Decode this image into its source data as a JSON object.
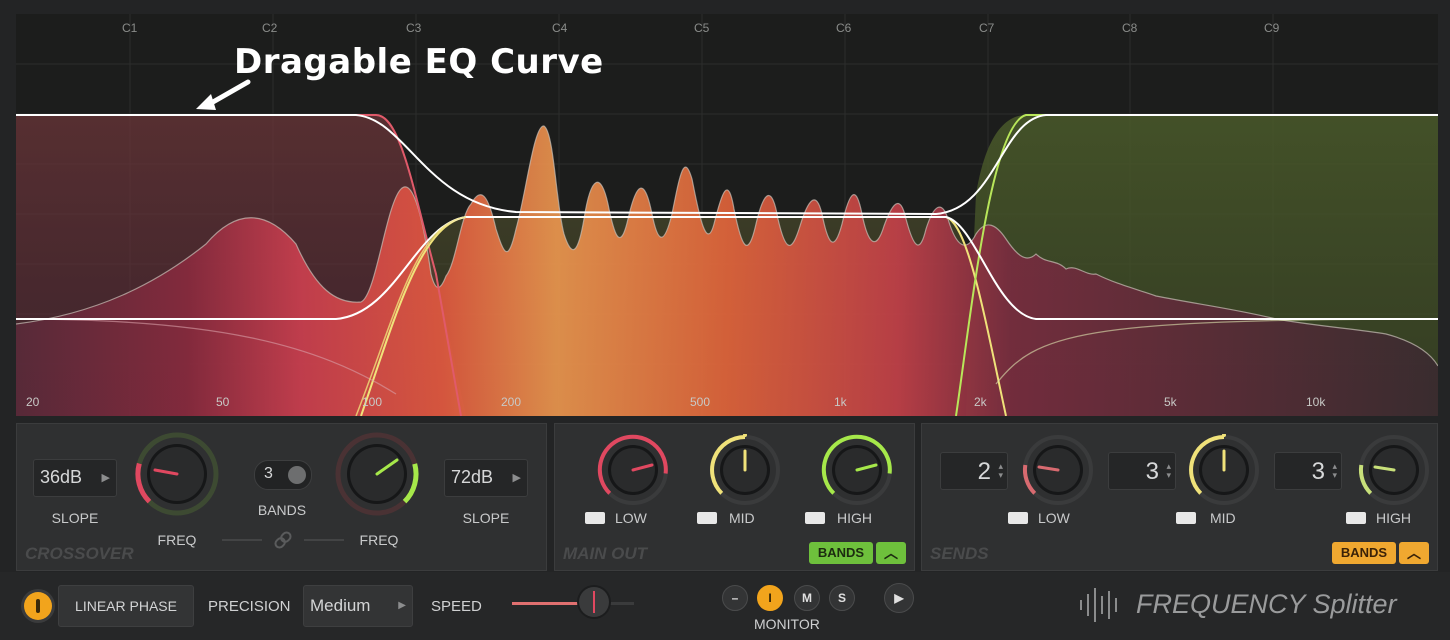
{
  "eq": {
    "annotation": "Dragable EQ Curve",
    "note_labels": [
      "C1",
      "C2",
      "C3",
      "C4",
      "C5",
      "C6",
      "C7",
      "C8",
      "C9"
    ],
    "freq_labels": [
      "20",
      "50",
      "100",
      "200",
      "500",
      "1k",
      "2k",
      "5k",
      "10k"
    ],
    "colors": {
      "low": "#d84a62",
      "mid": "#f0e27a",
      "high": "#a8d84a",
      "curve": "#ffffff"
    }
  },
  "crossover": {
    "title": "CROSSOVER",
    "slope_left_value": "36dB",
    "slope_left_label": "SLOPE",
    "freq_left_label": "FREQ",
    "bands_value": "3",
    "bands_label": "BANDS",
    "freq_right_label": "FREQ",
    "slope_right_value": "72dB",
    "slope_right_label": "SLOPE"
  },
  "main_out": {
    "title": "MAIN OUT",
    "low_label": "LOW",
    "mid_label": "MID",
    "high_label": "HIGH",
    "bands_button": "BANDS",
    "bands_color": "#6ec03c"
  },
  "sends": {
    "title": "SENDS",
    "low_value": "2",
    "low_label": "LOW",
    "mid_value": "3",
    "mid_label": "MID",
    "high_value": "3",
    "high_label": "HIGH",
    "bands_button": "BANDS",
    "bands_color": "#f0a830"
  },
  "bottom": {
    "linear_phase_label": "LINEAR PHASE",
    "precision_label": "PRECISION",
    "precision_value": "Medium",
    "speed_label": "SPEED",
    "monitor_label": "MONITOR",
    "monitor_buttons": [
      "–",
      "I",
      "M",
      "S"
    ],
    "brand": "FREQUENCY Splitter"
  }
}
